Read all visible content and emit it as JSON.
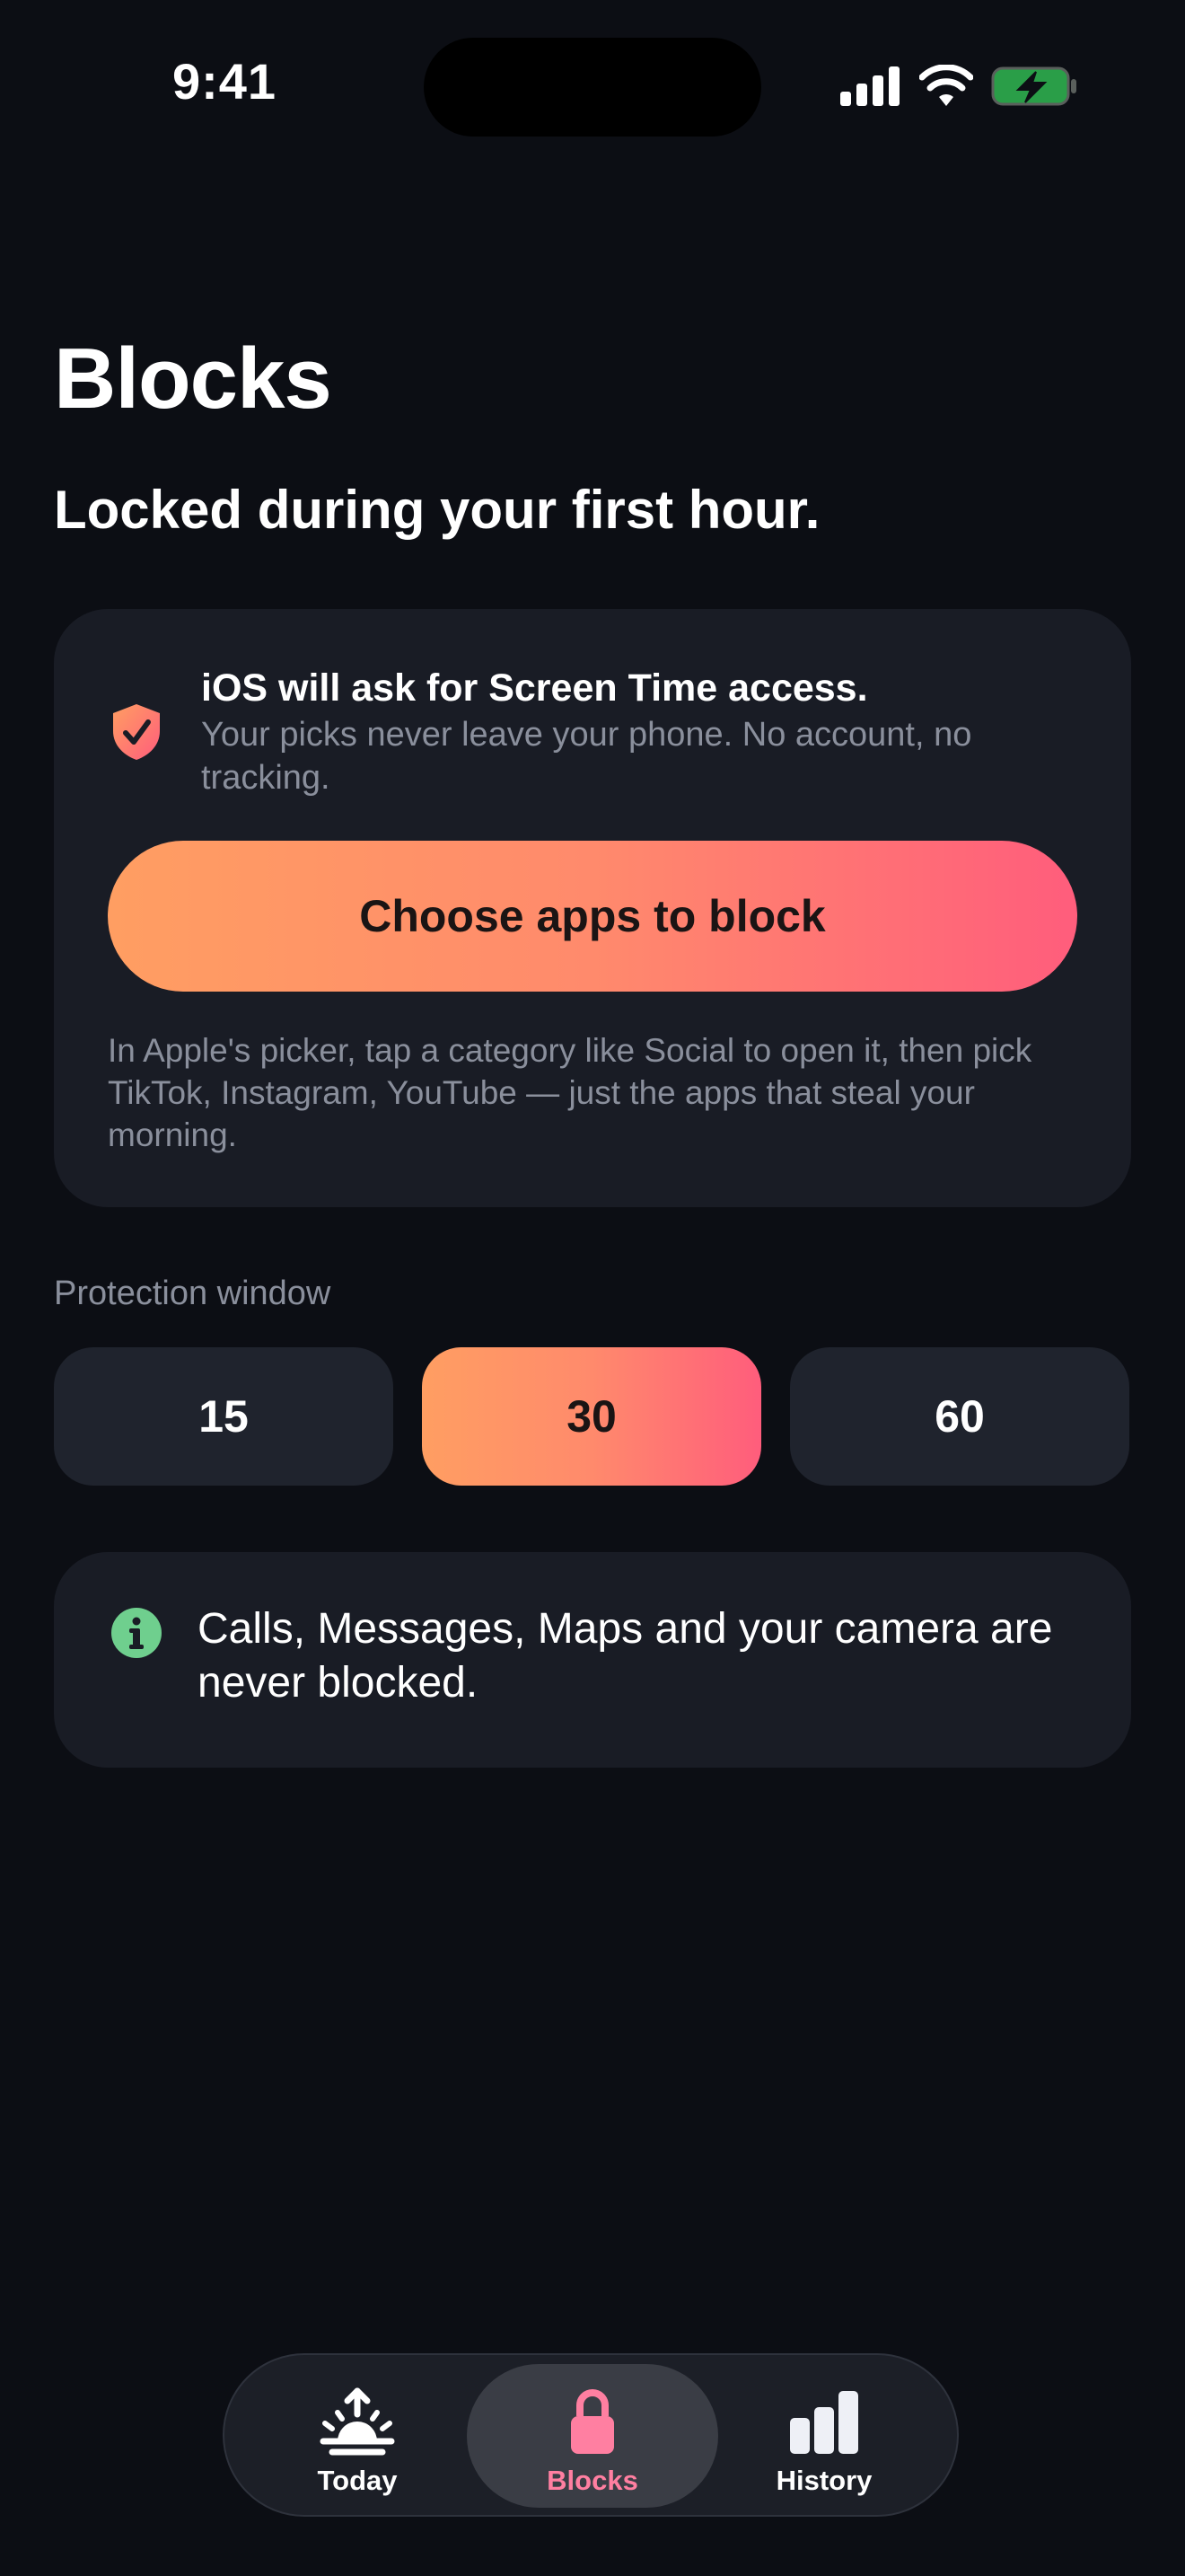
{
  "status_bar": {
    "time": "9:41",
    "signal_icon": "cellular-signal-icon",
    "wifi_icon": "wifi-icon",
    "battery_icon": "battery-charging-icon"
  },
  "header": {
    "title": "Blocks",
    "subtitle": "Locked during your first hour."
  },
  "access_card": {
    "icon": "shield-check-icon",
    "heading": "iOS will ask for Screen Time access.",
    "body": "Your picks never leave your phone. No account, no tracking.",
    "button_label": "Choose apps to block",
    "hint": "In Apple's picker, tap a category like Social to open it, then pick TikTok, Instagram, YouTube — just the apps that steal your morning."
  },
  "protection_window": {
    "label": "Protection window",
    "options": [
      "15",
      "30",
      "60"
    ],
    "selected": "30"
  },
  "info_card": {
    "icon": "info-icon",
    "text": "Calls, Messages, Maps and your camera are never blocked."
  },
  "tab_bar": {
    "tabs": [
      {
        "label": "Today",
        "icon": "sunrise-icon",
        "active": false
      },
      {
        "label": "Blocks",
        "icon": "lock-icon",
        "active": true
      },
      {
        "label": "History",
        "icon": "bar-chart-icon",
        "active": false
      }
    ]
  },
  "colors": {
    "background": "#0c0e14",
    "card": "#191c25",
    "accent_start": "#ff9e62",
    "accent_end": "#ff5d7c",
    "active_tab_label": "#ff7fa1",
    "info_green": "#6fcf8e"
  }
}
